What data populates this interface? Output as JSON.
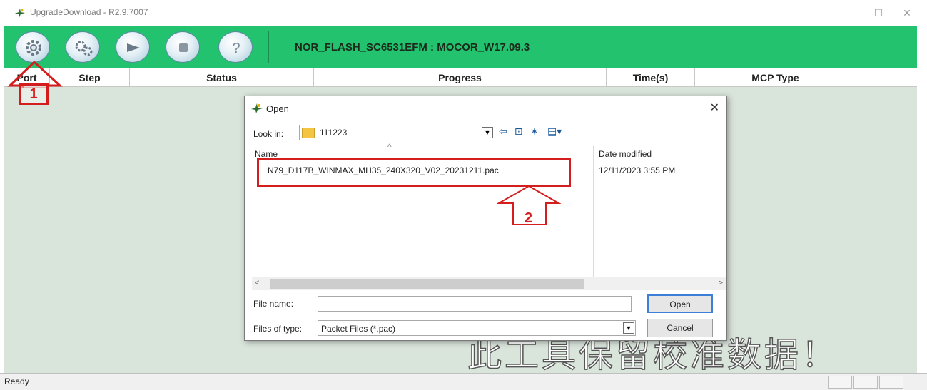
{
  "window": {
    "title": "UpgradeDownload - R2.9.7007",
    "minimize_glyph": "—",
    "maximize_glyph": "☐",
    "close_glyph": "✕"
  },
  "toolbar": {
    "buttons": [
      {
        "icon": "gear-icon",
        "label": ""
      },
      {
        "icon": "gears-icon",
        "label": ""
      },
      {
        "icon": "play-icon",
        "label": ""
      },
      {
        "icon": "stop-icon",
        "label": ""
      },
      {
        "icon": "help-icon",
        "label": "?"
      }
    ],
    "firmware_label": "NOR_FLASH_SC6531EFM : MOCOR_W17.09.3",
    "background_color": "#22c26e"
  },
  "table": {
    "columns": [
      "Port",
      "Step",
      "Status",
      "Progress",
      "Time(s)",
      "MCP Type"
    ]
  },
  "annotations": {
    "step1": "1",
    "step2": "2",
    "color": "#d41e1e"
  },
  "dialog": {
    "title": "Open",
    "close_glyph": "✕",
    "look_in_label": "Look in:",
    "look_in_value": "111223",
    "columns": {
      "name": "Name",
      "date": "Date modified"
    },
    "files": [
      {
        "name": "N79_D117B_WINMAX_MH35_240X320_V02_20231211.pac",
        "date": "12/11/2023 3:55 PM"
      }
    ],
    "file_name_label": "File name:",
    "file_name_value": "",
    "file_type_label": "Files of type:",
    "file_type_value": "Packet Files (*.pac)",
    "open_button": "Open",
    "cancel_button": "Cancel",
    "scroll_left": "<",
    "scroll_right": ">"
  },
  "watermark": "此工具保留校准数据！",
  "status": {
    "text": "Ready"
  }
}
